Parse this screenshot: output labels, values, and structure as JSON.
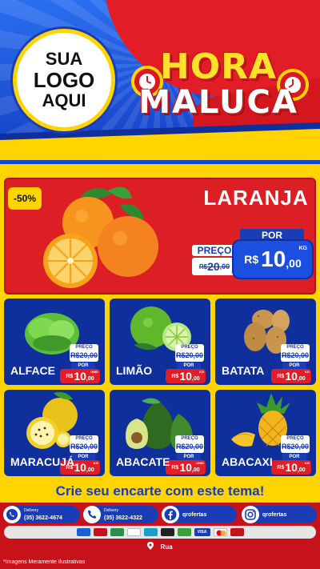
{
  "header": {
    "logo_lines": [
      "SUA",
      "LOGO",
      "AQUI"
    ],
    "title_line1": "HORA",
    "title_line2": "MALUCA"
  },
  "featured": {
    "discount_badge": "-50%",
    "name": "LARANJA",
    "old_label": "PREÇO",
    "old_price": {
      "currency": "R$",
      "amount": "20",
      "cents": ",00"
    },
    "new_label": "POR",
    "new_price": {
      "currency": "R$",
      "amount": "10",
      "cents": ",00",
      "unit": "KG"
    }
  },
  "products": [
    {
      "name": "ALFACE",
      "old_label": "PREÇO",
      "old_price": "R$20,00",
      "new_label": "POR",
      "currency": "R$",
      "amount": "10",
      "cents": ",00",
      "unit": "UNID"
    },
    {
      "name": "LIMÃO",
      "old_label": "PREÇO",
      "old_price": "R$20,00",
      "new_label": "POR",
      "currency": "R$",
      "amount": "10",
      "cents": ",00",
      "unit": "KG"
    },
    {
      "name": "BATATA",
      "old_label": "PREÇO",
      "old_price": "R$20,00",
      "new_label": "POR",
      "currency": "R$",
      "amount": "10",
      "cents": ",00",
      "unit": "KG"
    },
    {
      "name": "MARACUJÁ",
      "old_label": "PREÇO",
      "old_price": "R$20,00",
      "new_label": "POR",
      "currency": "R$",
      "amount": "10",
      "cents": ",00",
      "unit": "KG"
    },
    {
      "name": "ABACATE",
      "old_label": "PREÇO",
      "old_price": "R$20,00",
      "new_label": "POR",
      "currency": "R$",
      "amount": "10",
      "cents": ",00",
      "unit": "UNID"
    },
    {
      "name": "ABACAXI",
      "old_label": "PREÇO",
      "old_price": "R$20,00",
      "new_label": "POR",
      "currency": "R$",
      "amount": "10",
      "cents": ",00",
      "unit": "KG"
    }
  ],
  "cta": "Crie seu encarte com este tema!",
  "contacts": [
    {
      "icon": "whatsapp-icon",
      "label": "Delivery",
      "value": "(35) 3622-4674"
    },
    {
      "icon": "phone-icon",
      "label": "Delivery",
      "value": "(35) 3622-4322"
    },
    {
      "icon": "facebook-icon",
      "label": "",
      "value": "qrofertas"
    },
    {
      "icon": "instagram-icon",
      "label": "",
      "value": "qrofertas"
    }
  ],
  "payments": [
    "VISA"
  ],
  "address": "Rua",
  "disclaimer": "*Imagens Meramente Ilustrativas",
  "colors": {
    "brand_blue": "#1a3db6",
    "brand_red": "#e21d26",
    "brand_yellow": "#ffd400"
  }
}
